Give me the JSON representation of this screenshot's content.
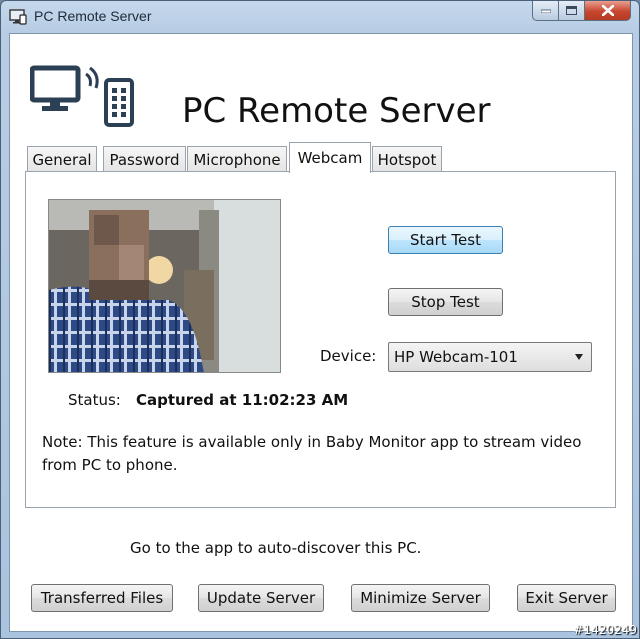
{
  "window": {
    "title": "PC Remote Server"
  },
  "header": {
    "app_title": "PC Remote Server"
  },
  "tabs": [
    {
      "label": "General"
    },
    {
      "label": "Password"
    },
    {
      "label": "Microphone"
    },
    {
      "label": "Webcam",
      "active": true
    },
    {
      "label": "Hotspot"
    }
  ],
  "webcam": {
    "start_test_label": "Start Test",
    "stop_test_label": "Stop Test",
    "device_label": "Device:",
    "device_value": "HP Webcam-101",
    "status_label": "Status:",
    "status_value": "Captured at 11:02:23 AM",
    "note": "Note: This feature is available only in Baby Monitor app to stream video from PC to phone."
  },
  "footer": {
    "discover_text": "Go to the app to auto-discover this PC.",
    "buttons": {
      "transferred_files": "Transferred Files",
      "update_server": "Update Server",
      "minimize_server": "Minimize Server",
      "exit_server": "Exit Server"
    }
  },
  "watermark": "#1420249",
  "colors": {
    "accent": "#3c7fb1",
    "close_button": "#c7462f"
  }
}
